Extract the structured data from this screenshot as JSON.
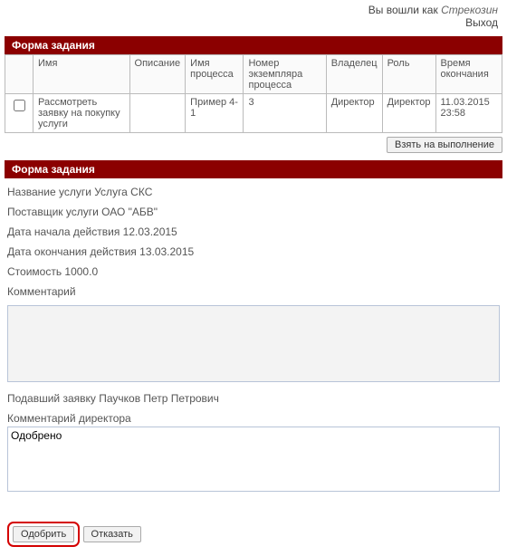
{
  "topbar": {
    "logged_in_as_prefix": "Вы вошли как ",
    "username": "Стрекозин",
    "logout": "Выход"
  },
  "section1": {
    "title": "Форма задания"
  },
  "grid": {
    "headers": {
      "name": "Имя",
      "description": "Описание",
      "process_name": "Имя процесса",
      "instance": "Номер экземпляра процесса",
      "owner": "Владелец",
      "role": "Роль",
      "due": "Время окончания"
    },
    "row": {
      "name": "Рассмотреть заявку на покупку услуги",
      "description": "",
      "process_name": "Пример 4-1",
      "instance": "3",
      "owner": "Директор",
      "role": "Директор",
      "due": "11.03.2015 23:58"
    }
  },
  "take_button": "Взять на выполнение",
  "section2": {
    "title": "Форма задания"
  },
  "form": {
    "service_name": "Название услуги Услуга СКС",
    "supplier": "Поставщик услуги ОАО \"АБВ\"",
    "start_date": "Дата начала действия 12.03.2015",
    "end_date": "Дата окончания действия 13.03.2015",
    "cost": "Стоимость 1000.0",
    "comment_label": "Комментарий",
    "comment_value": "",
    "submitter": "Подавший заявку Паучков Петр Петрович",
    "director_comment_label": "Комментарий директора",
    "director_comment_value": "Одобрено"
  },
  "actions": {
    "approve": "Одобрить",
    "reject": "Отказать"
  }
}
